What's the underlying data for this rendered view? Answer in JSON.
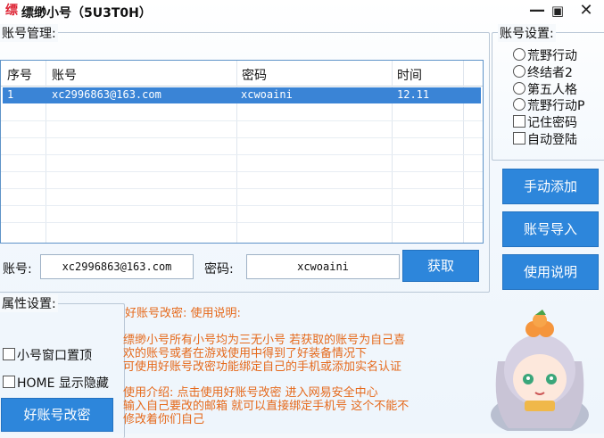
{
  "window": {
    "title": "缥缈小号（5U3T0H）",
    "icon_glyph": "缥",
    "minimize_glyph": "—",
    "maximize_glyph": "▣",
    "close_glyph": "✕"
  },
  "account_mgmt": {
    "label": "账号管理:",
    "columns": [
      "序号",
      "账号",
      "密码",
      "时间"
    ],
    "rows": [
      {
        "index": "1",
        "account": "xc2996863@163.com",
        "password": "xcwoaini",
        "time": "12.11"
      }
    ]
  },
  "fields": {
    "account_label": "账号:",
    "account_value": "xc2996863@163.com",
    "password_label": "密码:",
    "password_value": "xcwoaini",
    "fetch_button": "获取"
  },
  "settings": {
    "label": "账号设置:",
    "radios": [
      "荒野行动",
      "终结者2",
      "第五人格",
      "荒野行动P"
    ],
    "checkboxes": [
      "记住密码",
      "自动登陆"
    ],
    "buttons": [
      "手动添加",
      "账号导入",
      "使用说明"
    ]
  },
  "attributes": {
    "label": "属性设置:",
    "checkboxes": [
      "小号窗口置顶",
      "HOME 显示隐藏"
    ],
    "modify_button": "好账号改密"
  },
  "notes": {
    "heading": "好账号改密:      使用说明:",
    "lines": [
      "缥缈小号所有小号均为三无小号 若获取的账号为自己喜",
      "欢的账号或者在游戏使用中得到了好装备情况下",
      "可使用好账号改密功能绑定自己的手机或添加实名认证"
    ],
    "intro_lines": [
      "使用介绍:      点击使用好账号改密 进入网易安全中心",
      "输入自己要改的邮箱 就可以直接绑定手机号 这个不能不",
      "修改着你们自己"
    ]
  },
  "colors": {
    "accent_blue": "#2d86db",
    "selection_blue": "#3a84d6",
    "note_orange": "#e5691b"
  }
}
